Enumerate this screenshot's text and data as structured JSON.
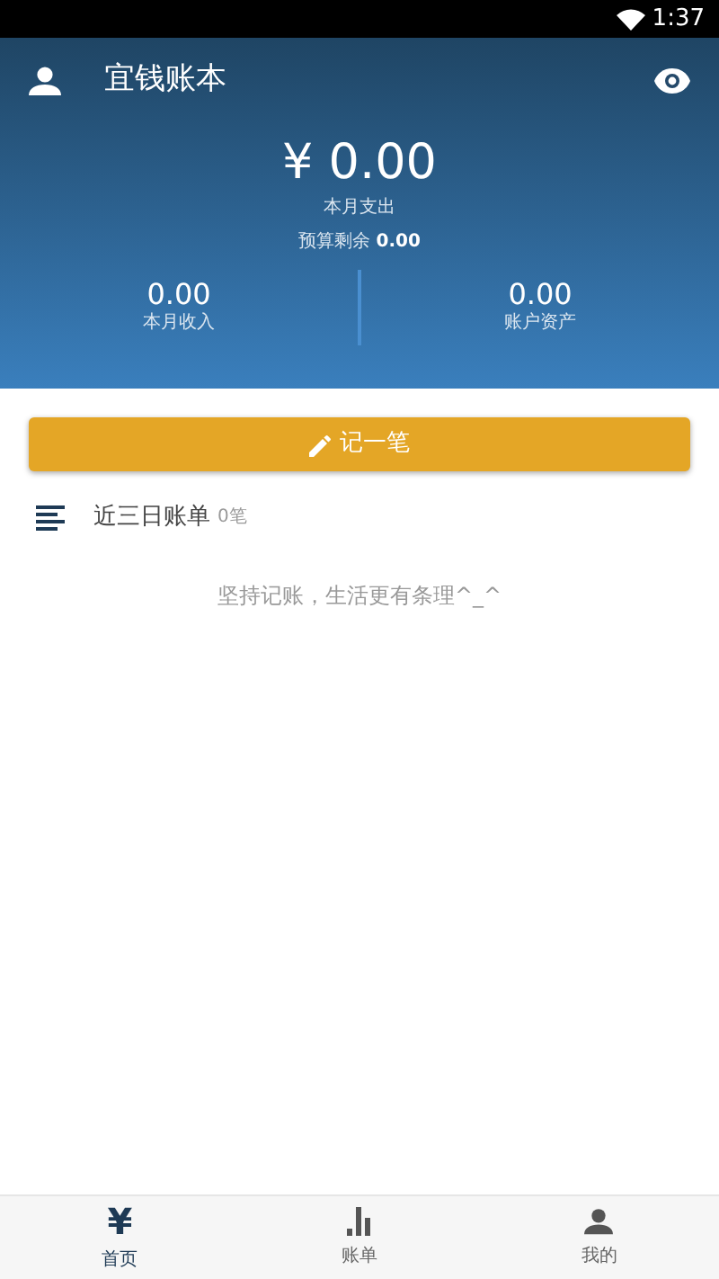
{
  "status_bar": {
    "time": "1:37"
  },
  "header": {
    "title": "宜钱账本"
  },
  "summary": {
    "amount": "¥ 0.00",
    "amount_label": "本月支出",
    "budget_label": "预算剩余",
    "budget_value": "0.00",
    "stats": [
      {
        "value": "0.00",
        "label": "本月收入"
      },
      {
        "value": "0.00",
        "label": "账户资产"
      }
    ]
  },
  "add_button": {
    "label": "记一笔"
  },
  "recent": {
    "title": "近三日账单",
    "count": "0笔",
    "empty_text": "坚持记账，生活更有条理^_^"
  },
  "tabs": [
    {
      "kind": "yen",
      "glyph": "¥",
      "label": "首页",
      "selected": true
    },
    {
      "kind": "bars",
      "label": "账单",
      "selected": false
    },
    {
      "kind": "person",
      "label": "我的",
      "selected": false
    }
  ]
}
